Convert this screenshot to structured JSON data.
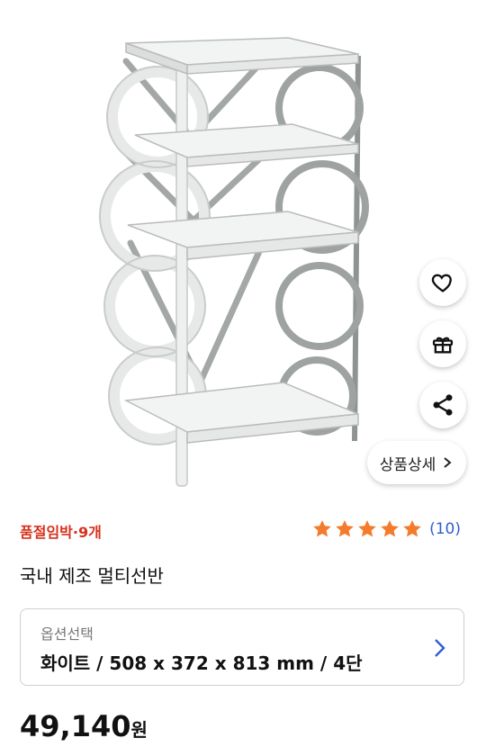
{
  "product": {
    "stock_badge": "품절임박·9개",
    "title": "국내 제조 멀티선반",
    "rating": {
      "stars": 5,
      "review_count": "(10)"
    },
    "option": {
      "label": "옵션선택",
      "value": "화이트 / 508 x 372 x 813 mm / 4단"
    },
    "price": {
      "amount": "49,140",
      "unit": "원"
    }
  },
  "actions": {
    "wishlist_icon": "heart-icon",
    "gift_icon": "gift-icon",
    "share_icon": "share-icon",
    "detail_label": "상품상세"
  },
  "colors": {
    "stock_red": "#d6301b",
    "star_orange": "#f47b2b",
    "review_blue": "#2f5fd0"
  }
}
